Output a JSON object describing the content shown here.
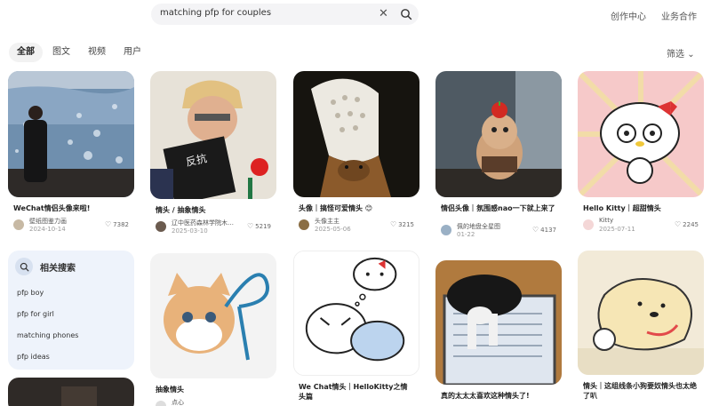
{
  "header": {
    "search_query": "matching pfp for couples",
    "links": [
      "创作中心",
      "业务合作"
    ]
  },
  "tabs": [
    {
      "label": "全部",
      "active": true
    },
    {
      "label": "图文",
      "active": false
    },
    {
      "label": "视频",
      "active": false
    },
    {
      "label": "用户",
      "active": false
    }
  ],
  "filter_label": "筛选",
  "related": {
    "title": "相关搜索",
    "items": [
      "pfp boy",
      "pfp for girl",
      "matching phones",
      "pfp ideas"
    ]
  },
  "cards": [
    {
      "title": "WeChat情侣头像来啦!",
      "author": "壁纸图鉴力画",
      "date": "2024-10-14",
      "likes": "7382"
    },
    {
      "title": "情头 / 抽象情头",
      "author": "辽中医药森林学院木木...",
      "date": "2025-03-10",
      "likes": "5219"
    },
    {
      "title": "头像｜搞怪可爱情头 😊",
      "author": "头像主主",
      "date": "2025-05-06",
      "likes": "3215"
    },
    {
      "title": "情侣头像｜氛围感nao一下就上来了",
      "author": "佩的地盘全星图",
      "date": "01-22",
      "likes": "4137"
    },
    {
      "title": "Hello Kitty｜超甜情头",
      "author": "Kitty",
      "date": "2025-07-11",
      "likes": "2245"
    },
    {
      "title": "抽象情头",
      "author": "点心",
      "date": "",
      "likes": ""
    },
    {
      "title": "We Chat情头｜HelloKitty之情头篇",
      "author": "",
      "date": "",
      "likes": ""
    },
    {
      "title": "真的太太太喜欢这种情头了!",
      "author": "",
      "date": "",
      "likes": ""
    },
    {
      "title": "情头｜这组线条小狗要奴情头也太绝了叭",
      "author": "",
      "date": "",
      "likes": ""
    }
  ]
}
